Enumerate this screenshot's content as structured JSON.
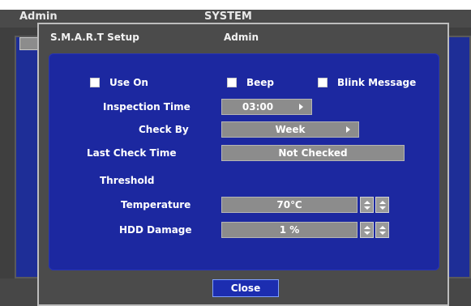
{
  "background": {
    "left_title": "Admin",
    "center_title": "SYSTEM"
  },
  "dialog": {
    "title": "S.M.A.R.T Setup",
    "subtitle": "Admin",
    "options": {
      "use_on": "Use On",
      "beep": "Beep",
      "blink_message": "Blink Message"
    },
    "fields": {
      "inspection_time": {
        "label": "Inspection Time",
        "value": "03:00"
      },
      "check_by": {
        "label": "Check By",
        "value": "Week"
      },
      "last_check_time": {
        "label": "Last Check Time",
        "value": "Not Checked"
      }
    },
    "threshold": {
      "heading": "Threshold",
      "temperature": {
        "label": "Temperature",
        "value": "70℃"
      },
      "hdd_damage": {
        "label": "HDD Damage",
        "value": "1 %"
      }
    },
    "close_label": "Close"
  },
  "colors": {
    "panel_blue": "#1c28a0",
    "dialog_gray": "#4b4b4b",
    "field_gray": "#8c8c8c"
  }
}
